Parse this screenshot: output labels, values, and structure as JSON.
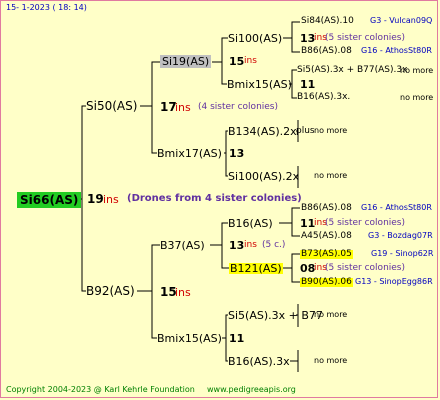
{
  "header": {
    "date": "15-  1-2023 ( 18: 14)"
  },
  "footer": {
    "copyright": "Copyright 2004-2023 @ Karl Kehrle Foundation",
    "site": "www.pedigreeapis.org"
  },
  "root": {
    "name": "Si66(AS)",
    "count": "19",
    "ins": "ins",
    "note": "(Drones from 4 sister colonies)"
  },
  "g1": {
    "top": {
      "name": "Si50(AS)",
      "count": "17",
      "ins": "ins",
      "note": "(4 sister colonies)"
    },
    "bottom": {
      "name": "B92(AS)",
      "count": "15",
      "ins": "ins"
    }
  },
  "g2": {
    "a": {
      "name": "Si19(AS)",
      "count": "15",
      "ins": "ins"
    },
    "b": {
      "name": "Bmix17(AS)",
      "count": "13"
    },
    "c": {
      "name": "B37(AS)",
      "count": "13",
      "ins": "ins",
      "note": "(5 c.)"
    },
    "d": {
      "name": "Bmix15(AS)",
      "count": "11"
    }
  },
  "g3": {
    "a1": {
      "name": "Si100(AS)",
      "count": "15",
      "ins": "ins"
    },
    "a2": {
      "name": "Bmix15(AS)",
      "count": "11"
    },
    "b1": {
      "name": "B134(AS).2x",
      "extra": "plus",
      "nomore": "no more"
    },
    "b2": {
      "name": "Si100(AS).2x",
      "nomore": "no more"
    },
    "c1": {
      "name": "B16(AS)",
      "count": "11",
      "ins": "ins",
      "note": "(5 sister colonies)"
    },
    "c2": {
      "name": "B121(AS)",
      "count": "08",
      "ins": "ins",
      "note": "(5 sister colonies)"
    },
    "d1": {
      "name": "Si5(AS).3x + B77",
      "nomore": "no more"
    },
    "d2": {
      "name": "B16(AS).3x",
      "nomore": "no more"
    }
  },
  "g4": {
    "a1a": {
      "name": "Si84(AS).10",
      "info": "G3 - Vulcan09Q"
    },
    "a1n": {
      "count": "13",
      "ins": "ins",
      "note": "(5 sister colonies)"
    },
    "a1b": {
      "name": "B86(AS).08",
      "info": "G16 - AthosSt80R"
    },
    "a2a": {
      "name": "Si5(AS).3x + B77(AS).3x",
      "nomore": "no more"
    },
    "a2b": {
      "name": "B16(AS).3x.",
      "nomore": "no more"
    },
    "c1a": {
      "name": "B86(AS).08",
      "info": "G16 - AthosSt80R"
    },
    "c1b": {
      "name": "A45(AS).08",
      "info": "G3 - Bozdag07R"
    },
    "c2a": {
      "name": "B73(AS).05",
      "info": "G19 - Sinop62R"
    },
    "c2b": {
      "name": "B90(AS).06",
      "info": "G13 - SinopEgg86R"
    }
  }
}
